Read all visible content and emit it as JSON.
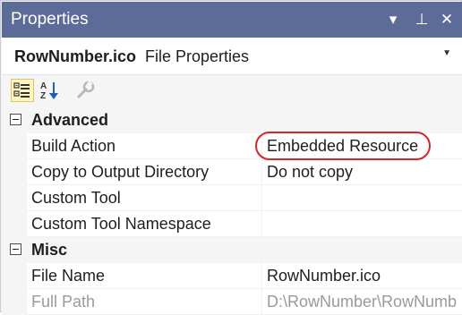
{
  "window": {
    "title": "Properties",
    "controls": {
      "dropdown_glyph": "▾",
      "pin_glyph": "⊥",
      "close_glyph": "✕"
    }
  },
  "object": {
    "name": "RowNumber.ico",
    "type": "File Properties"
  },
  "toolbar": {
    "tools": [
      {
        "name": "categorized-icon",
        "active": true
      },
      {
        "name": "alphabetical-icon",
        "active": false
      },
      {
        "name": "property-pages-icon",
        "active": false,
        "disabled": true
      }
    ]
  },
  "grid": {
    "categories": [
      {
        "label": "Advanced",
        "properties": [
          {
            "name": "Build Action",
            "value": "Embedded Resource"
          },
          {
            "name": "Copy to Output Directory",
            "value": "Do not copy"
          },
          {
            "name": "Custom Tool",
            "value": ""
          },
          {
            "name": "Custom Tool Namespace",
            "value": ""
          }
        ]
      },
      {
        "label": "Misc",
        "properties": [
          {
            "name": "File Name",
            "value": "RowNumber.ico"
          },
          {
            "name": "Full Path",
            "value": "D:\\RowNumber\\RowNumb",
            "disabled": true
          }
        ]
      }
    ]
  },
  "colors": {
    "titlebar": "#5d6b99",
    "highlight_ring": "#d8232a",
    "disabled_text": "#9a9a9a"
  }
}
